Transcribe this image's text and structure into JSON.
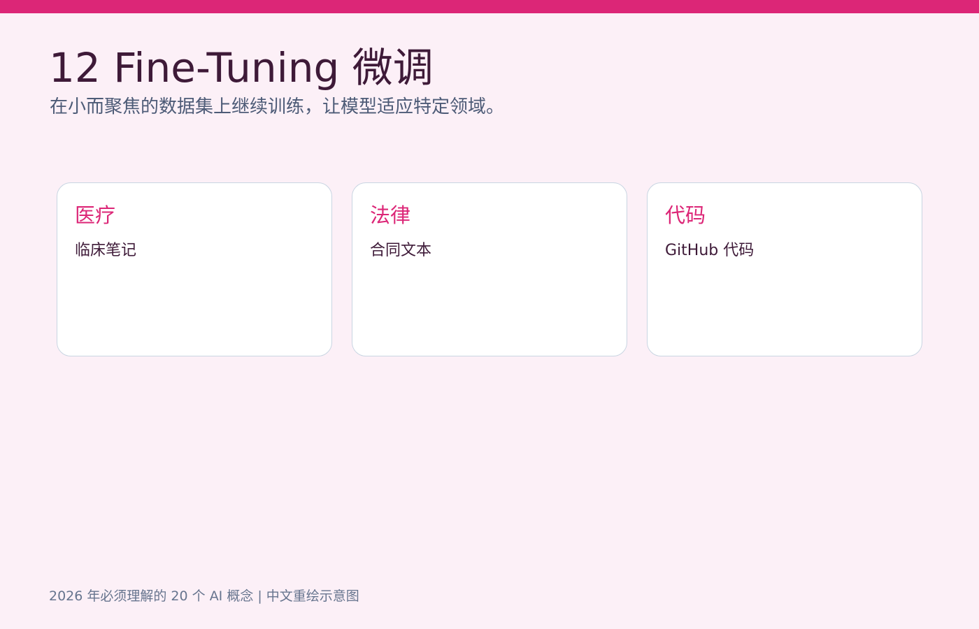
{
  "header": {
    "title": "12 Fine-Tuning 微调",
    "subtitle": "在小而聚焦的数据集上继续训练，让模型适应特定领域。"
  },
  "cards": [
    {
      "title": "医疗",
      "description": "临床笔记"
    },
    {
      "title": "法律",
      "description": "合同文本"
    },
    {
      "title": "代码",
      "description": "GitHub 代码"
    }
  ],
  "footer": {
    "text": "2026 年必须理解的 20 个 AI 概念 | 中文重绘示意图"
  },
  "colors": {
    "accent": "#dc2677",
    "background": "#fcf0f7",
    "title_text": "#3e1a38",
    "subtitle_text": "#4d5b77",
    "card_border": "#c9d5e2"
  }
}
